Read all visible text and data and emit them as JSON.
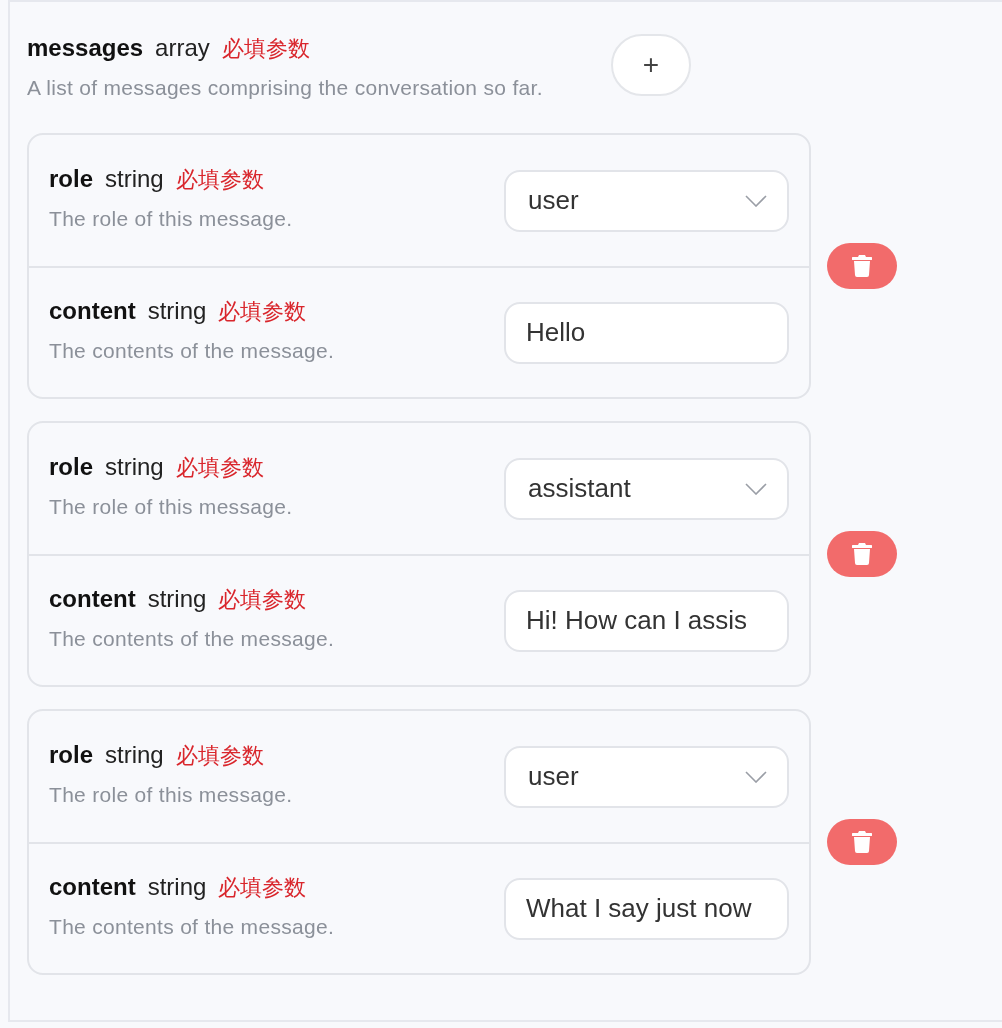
{
  "parameter": {
    "name": "messages",
    "type": "array",
    "required_label": "必填参数",
    "description": "A list of messages comprising the conversation so far."
  },
  "add_button": "+",
  "items": [
    {
      "fields": [
        {
          "kind": "select",
          "name": "role",
          "type": "string",
          "required_label": "必填参数",
          "description": "The role of this message.",
          "value": "user"
        },
        {
          "kind": "text",
          "name": "content",
          "type": "string",
          "required_label": "必填参数",
          "description": "The contents of the message.",
          "value": "Hello"
        }
      ]
    },
    {
      "fields": [
        {
          "kind": "select",
          "name": "role",
          "type": "string",
          "required_label": "必填参数",
          "description": "The role of this message.",
          "value": "assistant"
        },
        {
          "kind": "text",
          "name": "content",
          "type": "string",
          "required_label": "必填参数",
          "description": "The contents of the message.",
          "value": "Hi! How can I assis"
        }
      ]
    },
    {
      "fields": [
        {
          "kind": "select",
          "name": "role",
          "type": "string",
          "required_label": "必填参数",
          "description": "The role of this message.",
          "value": "user"
        },
        {
          "kind": "text",
          "name": "content",
          "type": "string",
          "required_label": "必填参数",
          "description": "The contents of the message.",
          "value": "What I say just now"
        }
      ]
    }
  ]
}
